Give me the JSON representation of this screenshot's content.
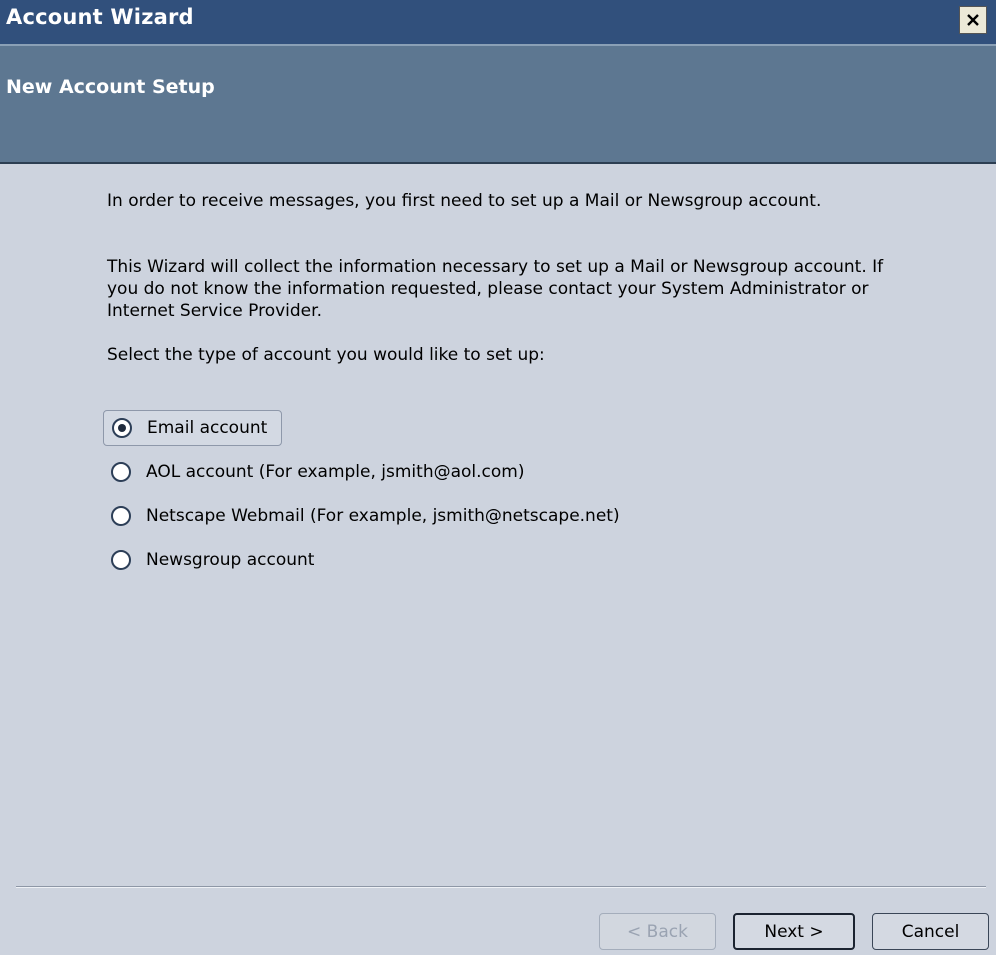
{
  "window": {
    "title": "Account Wizard",
    "close_glyph": "✕"
  },
  "header": {
    "title": "New Account Setup"
  },
  "body": {
    "intro": "In order to receive messages, you first need to set up a Mail or Newsgroup account.",
    "info": "This Wizard will collect the information necessary to set up a Mail or Newsgroup account. If you do not know the information requested, please contact your System Administrator or Internet Service Provider.",
    "prompt": "Select the type of account you would like to set up:"
  },
  "account_types": [
    {
      "label": "Email account",
      "selected": true
    },
    {
      "label": "AOL account (For example, jsmith@aol.com)",
      "selected": false
    },
    {
      "label": "Netscape Webmail (For example, jsmith@netscape.net)",
      "selected": false
    },
    {
      "label": "Newsgroup account",
      "selected": false
    }
  ],
  "buttons": {
    "back": "< Back",
    "next": "Next >",
    "cancel": "Cancel"
  },
  "colors": {
    "titlebar": "#31507c",
    "header": "#5d7791",
    "background": "#cdd3de"
  }
}
